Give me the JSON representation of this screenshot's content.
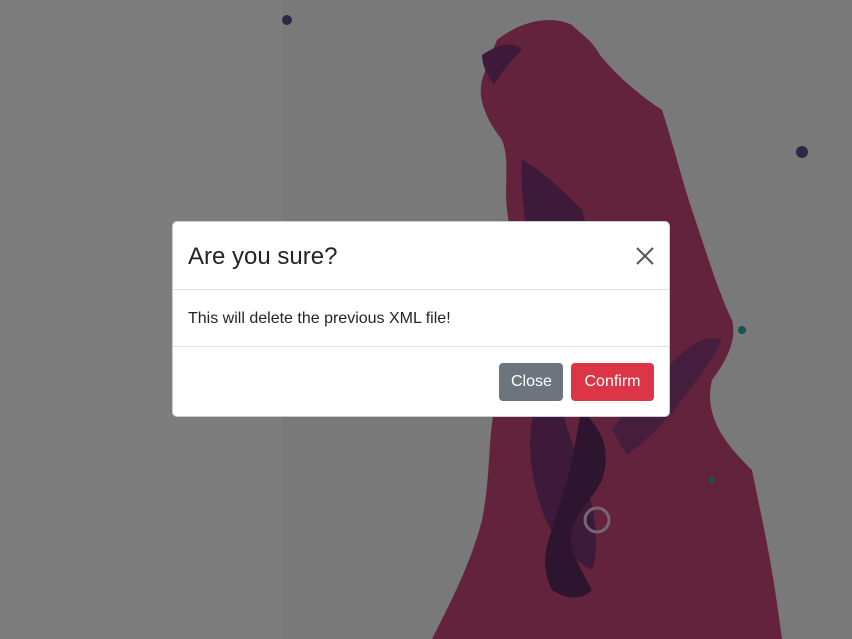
{
  "colors": {
    "backdrop": "rgba(0,0,0,0.5)",
    "secondary_button": "#6c757d",
    "danger_button": "#dc3545",
    "tissue_pink": "#c9467a",
    "tissue_purple": "#6a2d6a"
  },
  "modal": {
    "title": "Are you sure?",
    "body_text": "This will delete the previous XML file!",
    "close_icon": "close-icon",
    "buttons": {
      "close_label": "Close",
      "confirm_label": "Confirm"
    }
  }
}
